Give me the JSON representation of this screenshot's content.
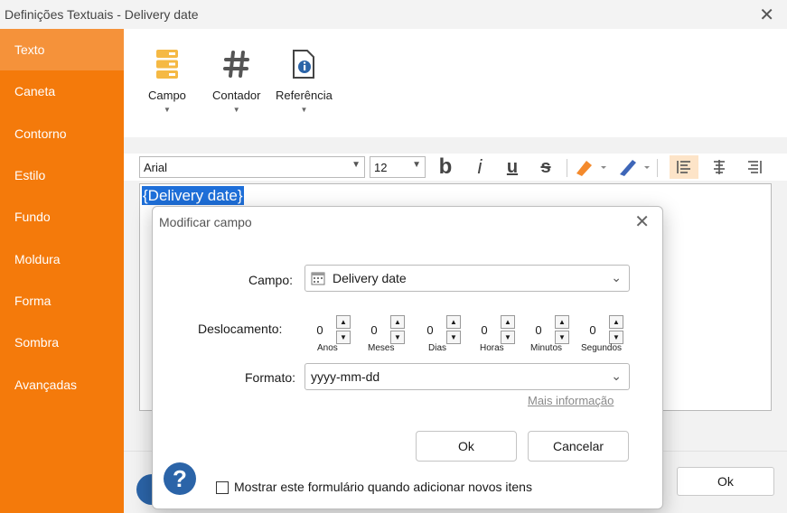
{
  "window": {
    "title": "Definições Textuais - Delivery date",
    "close": "✕"
  },
  "sidebar": {
    "items": [
      {
        "label": "Texto"
      },
      {
        "label": "Caneta"
      },
      {
        "label": "Contorno"
      },
      {
        "label": "Estilo"
      },
      {
        "label": "Fundo"
      },
      {
        "label": "Moldura"
      },
      {
        "label": "Forma"
      },
      {
        "label": "Sombra"
      },
      {
        "label": "Avançadas"
      }
    ],
    "active_index": 0
  },
  "toolbar": {
    "campo_label": "Campo",
    "contador_label": "Contador",
    "referencia_label": "Referência",
    "font_family": "Arial",
    "font_size": "12"
  },
  "editor": {
    "content": "{Delivery date}"
  },
  "main": {
    "ok_label": "Ok"
  },
  "dialog": {
    "title": "Modificar campo",
    "campo_label": "Campo:",
    "campo_value": "Delivery date",
    "deslocamento_label": "Deslocamento:",
    "offsets": [
      {
        "value": "0",
        "caption": "Anos"
      },
      {
        "value": "0",
        "caption": "Meses"
      },
      {
        "value": "0",
        "caption": "Dias"
      },
      {
        "value": "0",
        "caption": "Horas"
      },
      {
        "value": "0",
        "caption": "Minutos"
      },
      {
        "value": "0",
        "caption": "Segundos"
      }
    ],
    "formato_label": "Formato:",
    "formato_value": "yyyy-mm-dd",
    "more_info": "Mais informação",
    "ok_label": "Ok",
    "cancel_label": "Cancelar",
    "show_form_label": "Mostrar este formulário quando adicionar novos itens",
    "show_form_checked": false
  },
  "colors": {
    "sidebar": "#f47a0b",
    "sidebar_active": "#f5923a",
    "selection": "#1e6fd9",
    "help": "#2b64a8"
  }
}
